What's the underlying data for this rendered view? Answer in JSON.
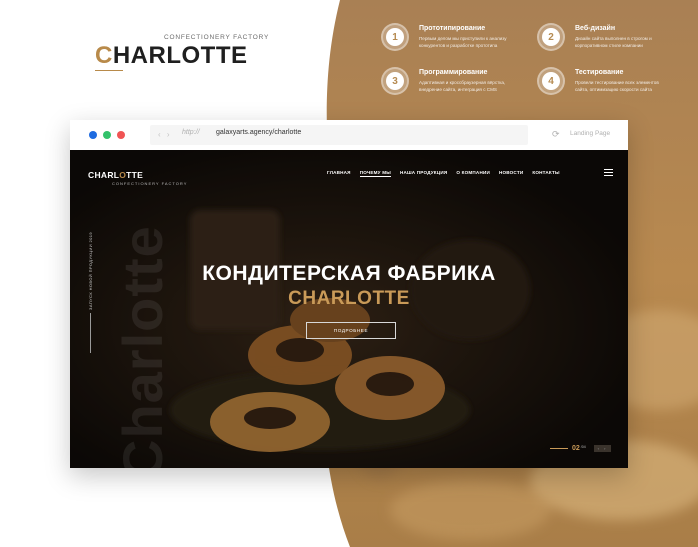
{
  "brand": {
    "tagline": "CONFECTIONERY FACTORY",
    "name_first": "C",
    "name_rest": "HARLOTTE"
  },
  "features": [
    {
      "num": "1",
      "title": "Прототипирование",
      "desc": "Первым делом мы приступили к анализу конкурентов и разработке прототипа"
    },
    {
      "num": "2",
      "title": "Веб-дизайн",
      "desc": "Дизайн сайта выполнен в строгом и корпоративном стиле компании"
    },
    {
      "num": "3",
      "title": "Программирование",
      "desc": "Адаптивная и кроссбраузерная вёрстка, внедрение сайта, интеграция с CMS"
    },
    {
      "num": "4",
      "title": "Тестирование",
      "desc": "Провели тестирование всех элементов сайта, оптимизацию скорости сайта"
    }
  ],
  "browser": {
    "nav_arrows": "‹ ›",
    "url_protocol": "http://",
    "url": "galaxyarts.agency/charlotte",
    "refresh_icon": "refresh-icon",
    "refresh_glyph": "⟳",
    "landing_label": "Landing Page"
  },
  "site": {
    "logo_pre": "CHARL",
    "logo_o": "O",
    "logo_post": "TTE",
    "logo_tagline": "CONFECTIONERY FACTORY",
    "menu": [
      "ГЛАВНАЯ",
      "ПОЧЕМУ МЫ",
      "НАША ПРОДУКЦИЯ",
      "О КОМПАНИИ",
      "НОВОСТИ",
      "КОНТАКТЫ"
    ],
    "active_menu_index": 1,
    "vertical_caption": "ЗАПУСК НОВОЙ ПРОДУКЦИИ 2019",
    "big_vertical": "Charlotte",
    "hero_line1": "КОНДИТЕРСКАЯ ФАБРИКА",
    "hero_line2": "CHARLOTTE",
    "more_button": "ПОДРОБНЕЕ",
    "slide_current": "02",
    "slide_total": "/04",
    "slide_arrows": "‹ ›"
  },
  "colors": {
    "gold": "#b88a4a",
    "gold_light": "#c99a58",
    "dark_bg": "#17120d",
    "dot_blue": "#1e6be0",
    "dot_green": "#33c26b",
    "dot_red": "#f05454"
  }
}
